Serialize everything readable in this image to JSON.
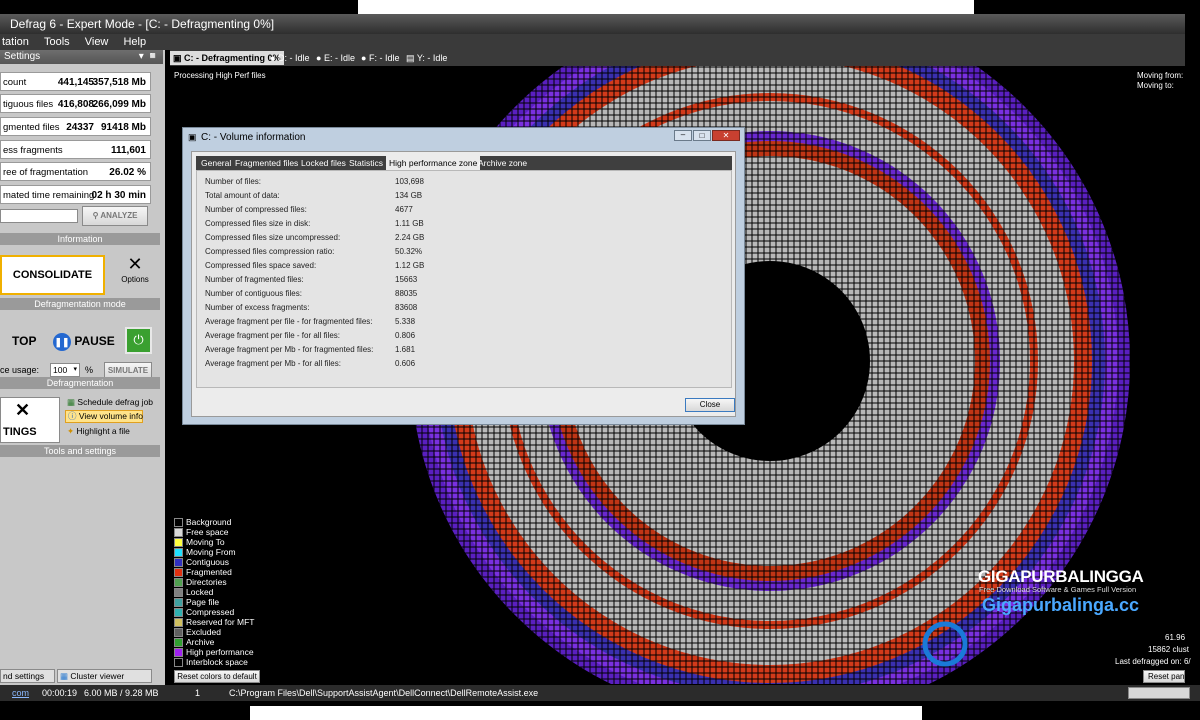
{
  "window": {
    "title": "Defrag 6 - Expert Mode - [C: - Defragmenting 0%]"
  },
  "menu": [
    "tation",
    "Tools",
    "View",
    "Help"
  ],
  "left_panel": {
    "header": "Settings",
    "stats": [
      {
        "label": "count",
        "v1": "441,145",
        "v2": "357,518 Mb"
      },
      {
        "label": "tiguous files",
        "v1": "416,808",
        "v2": "266,099 Mb"
      },
      {
        "label": "gmented files",
        "v1": "24337",
        "v2": "91418 Mb"
      },
      {
        "label": "ess fragments",
        "v": "111,601"
      },
      {
        "label": "ree of fragmentation",
        "v": "26.02 %"
      },
      {
        "label": "mated time remaining",
        "v": "02 h 30 min"
      }
    ],
    "analyze": "ANALYZE",
    "info_label": "Information",
    "consolidate": "CONSOLIDATE",
    "options": "Options",
    "mode_label": "Defragmentation mode",
    "stop": "TOP",
    "pause": "PAUSE",
    "usage_label": "ce usage:",
    "usage_value": "100",
    "usage_unit": "%",
    "simulate": "SIMULATE",
    "defrag_label": "Defragmentation",
    "schedule": "Schedule defrag job",
    "view_volume": "View volume info",
    "highlight": "Highlight a file",
    "settings": "TINGS",
    "tools_label": "Tools and settings",
    "bottom_tab1": "nd settings",
    "bottom_tab2": "Cluster viewer"
  },
  "tabs": [
    {
      "label": "C: - Defragmenting 0%",
      "active": true
    },
    {
      "label": "D: - Idle"
    },
    {
      "label": "E: - Idle"
    },
    {
      "label": "F: - Idle"
    },
    {
      "label": "Y: - Idle"
    }
  ],
  "processing": "Processing High Perf files",
  "moving_from": "Moving from:",
  "moving_to": "Moving to:",
  "dialog": {
    "title": "C: - Volume information",
    "tabs": [
      "General",
      "Fragmented files",
      "Locked files",
      "Statistics",
      "High performance zone",
      "Archive zone"
    ],
    "active_tab": 4,
    "rows": [
      {
        "label": "Number of files:",
        "value": "103,698"
      },
      {
        "label": "Total amount of data:",
        "value": "134 GB"
      },
      {
        "label": "Number of compressed files:",
        "value": "4677"
      },
      {
        "label": "Compressed files size in disk:",
        "value": "1.11 GB"
      },
      {
        "label": "Compressed files size uncompressed:",
        "value": "2.24 GB"
      },
      {
        "label": "Compressed files compression ratio:",
        "value": "50.32%"
      },
      {
        "label": "Compressed files space saved:",
        "value": "1.12 GB"
      },
      {
        "label": "Number of fragmented files:",
        "value": "15663"
      },
      {
        "label": "Number of contiguous files:",
        "value": "88035"
      },
      {
        "label": "Number of excess fragments:",
        "value": "83608"
      },
      {
        "label": "Average fragment per file - for fragmented files:",
        "value": "5.338"
      },
      {
        "label": "Average fragment per file - for all files:",
        "value": "0.806"
      },
      {
        "label": "Average fragment per Mb - for fragmented files:",
        "value": "1.681"
      },
      {
        "label": "Average fragment per Mb - for all files:",
        "value": "0.606"
      }
    ],
    "close": "Close"
  },
  "legend": [
    {
      "label": "Background",
      "color": "#000000"
    },
    {
      "label": "Free space",
      "color": "#d8d8d8"
    },
    {
      "label": "Moving To",
      "color": "#ffff40"
    },
    {
      "label": "Moving From",
      "color": "#20e0ff"
    },
    {
      "label": "Contiguous",
      "color": "#3030c0"
    },
    {
      "label": "Fragmented",
      "color": "#e03010"
    },
    {
      "label": "Directories",
      "color": "#50a050"
    },
    {
      "label": "Locked",
      "color": "#808080"
    },
    {
      "label": "Page file",
      "color": "#40a0a0"
    },
    {
      "label": "Compressed",
      "color": "#30b0b0"
    },
    {
      "label": "Reserved for MFT",
      "color": "#d0c060"
    },
    {
      "label": "Excluded",
      "color": "#606060"
    },
    {
      "label": "Archive",
      "color": "#30a030"
    },
    {
      "label": "High performance",
      "color": "#a020f0"
    },
    {
      "label": "Interblock space",
      "color": "#000000"
    }
  ],
  "reset_colors": "Reset colors to default",
  "right_info": [
    "61.96",
    "15862 clust",
    "Last defragged on: 6/"
  ],
  "reset_right": "Reset pan",
  "status": {
    "left": "com",
    "time": "00:00:19",
    "mem": "6.00 MB / 9.28 MB",
    "num": "1",
    "path": "C:\\Program Files\\Dell\\SupportAssistAgent\\DellConnect\\DellRemoteAssist.exe"
  },
  "watermark": {
    "title": "GIGAPURBALINGGA",
    "sub": "Free Download Software & Games Full Version",
    "url": "Gigapurbalinga.cc"
  }
}
